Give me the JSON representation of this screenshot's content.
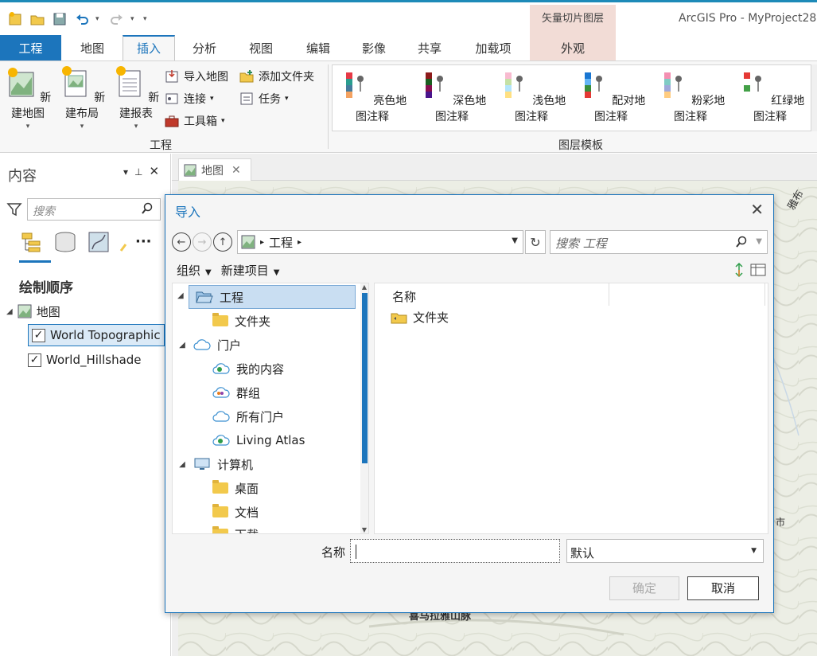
{
  "app": {
    "title": "ArcGIS Pro - MyProject28",
    "context_group": "矢量切片图层"
  },
  "tabs": [
    {
      "label": "工程"
    },
    {
      "label": "地图"
    },
    {
      "label": "插入"
    },
    {
      "label": "分析"
    },
    {
      "label": "视图"
    },
    {
      "label": "编辑"
    },
    {
      "label": "影像"
    },
    {
      "label": "共享"
    },
    {
      "label": "加载项"
    },
    {
      "label": "外观"
    }
  ],
  "ribbon": {
    "project_group": {
      "label": "工程",
      "large": [
        "新建地图",
        "新建布局",
        "新建报表"
      ],
      "small": [
        "导入地图",
        "添加文件夹",
        "连接",
        "任务",
        "工具箱"
      ]
    },
    "templates_group": {
      "label": "图层模板",
      "items": [
        "亮色地图注释",
        "深色地图注释",
        "浅色地图注释",
        "配对地图注释",
        "粉彩地图注释",
        "红绿地图注释"
      ]
    }
  },
  "contents": {
    "title": "内容",
    "search_placeholder": "搜索",
    "draw_order": "绘制顺序",
    "map_label": "地图",
    "layers": [
      "World Topographic",
      "World_Hillshade"
    ]
  },
  "map_tab": {
    "label": "地图"
  },
  "map_labels": [
    "雅布",
    "市",
    "喜马拉雅山脉"
  ],
  "dialog": {
    "title": "导入",
    "path": "工程",
    "search_placeholder": "搜索 工程",
    "organize": "组织",
    "new_item": "新建项目",
    "tree": [
      {
        "label": "工程"
      },
      {
        "label": "文件夹"
      },
      {
        "label": "门户"
      },
      {
        "label": "我的内容"
      },
      {
        "label": "群组"
      },
      {
        "label": "所有门户"
      },
      {
        "label": "Living Atlas"
      },
      {
        "label": "计算机"
      },
      {
        "label": "桌面"
      },
      {
        "label": "文档"
      },
      {
        "label": "下载"
      }
    ],
    "column_name": "名称",
    "list_items": [
      "文件夹"
    ],
    "name_label": "名称",
    "name_value": "",
    "type_value": "默认",
    "ok": "确定",
    "cancel": "取消"
  }
}
